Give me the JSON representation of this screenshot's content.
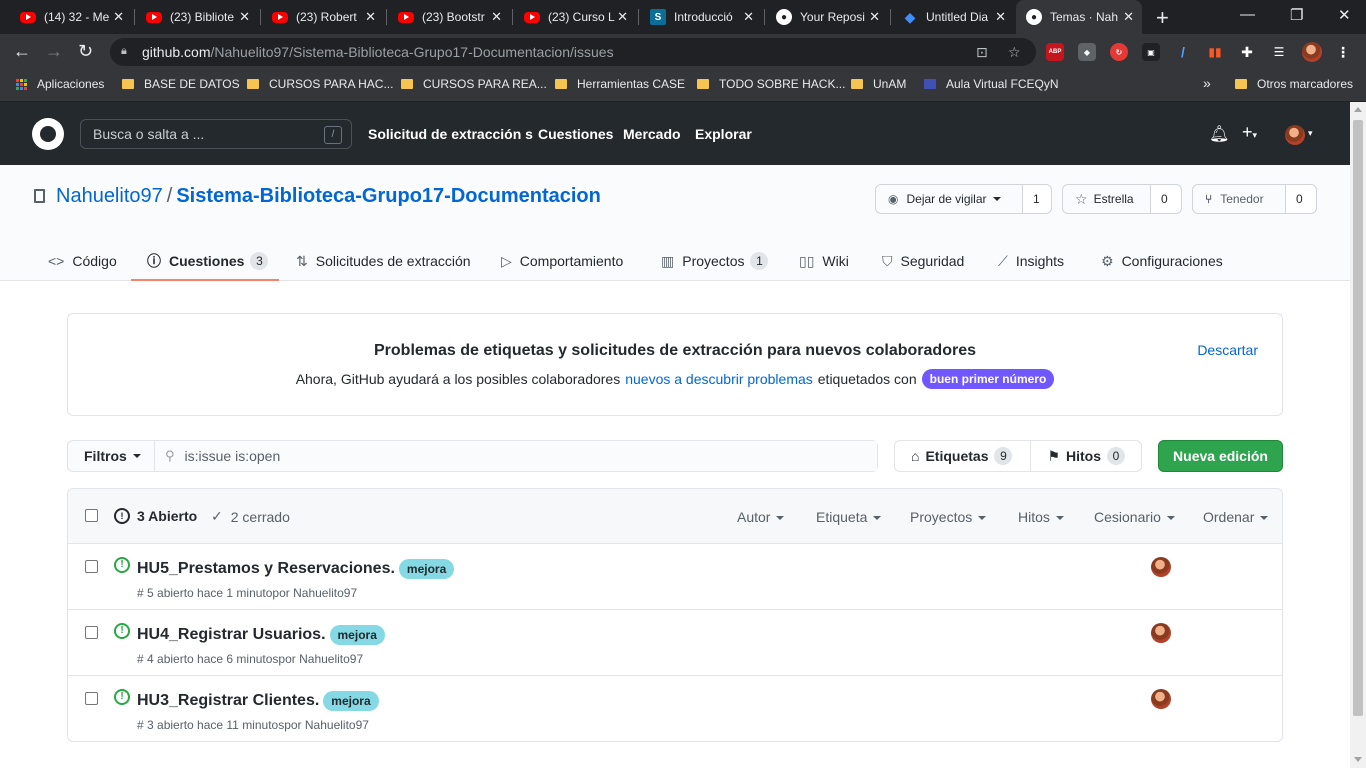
{
  "browser": {
    "tabs": [
      {
        "title": "(14) 32 - Me",
        "icon": "youtube-icon"
      },
      {
        "title": "(23) Bibliote",
        "icon": "youtube-icon"
      },
      {
        "title": "(23) Robert",
        "icon": "youtube-icon"
      },
      {
        "title": "(23) Bootstr",
        "icon": "youtube-icon"
      },
      {
        "title": "(23) Curso L",
        "icon": "youtube-icon"
      },
      {
        "title": "Introducció",
        "icon": "stackedit-icon"
      },
      {
        "title": "Your Reposi",
        "icon": "github-icon"
      },
      {
        "title": "Untitled Dia",
        "icon": "drawio-icon"
      },
      {
        "title": "Temas · Nah",
        "icon": "github-icon"
      }
    ],
    "url_host": "github.com",
    "url_path": "/Nahuelito97/Sistema-Biblioteca-Grupo17-Documentacion/issues",
    "bookmarks": [
      "Aplicaciones",
      "BASE DE DATOS",
      "CURSOS PARA HAC...",
      "CURSOS PARA REA...",
      "Herramientas CASE",
      "TODO SOBRE HACK...",
      "UnAM",
      "Aula Virtual FCEQyN"
    ],
    "bookmarks_overflow": "»",
    "other_bookmarks": "Otros marcadores",
    "ext_abp": "ABP"
  },
  "github": {
    "search_placeholder": "Busca o salta a ...",
    "search_key": "/",
    "nav": [
      "Solicitud de extracción s",
      "Cuestiones",
      "Mercado",
      "Explorar"
    ],
    "owner": "Nahuelito97",
    "repo": "Sistema-Biblioteca-Grupo17-Documentacion",
    "watch_label": "Dejar de vigilar",
    "watch_count": "1",
    "star_label": "Estrella",
    "star_count": "0",
    "fork_label": "Tenedor",
    "fork_count": "0",
    "tabs": [
      {
        "label": "Código"
      },
      {
        "label": "Cuestiones",
        "count": "3"
      },
      {
        "label": "Solicitudes de extracción"
      },
      {
        "label": "Comportamiento"
      },
      {
        "label": "Proyectos",
        "count": "1"
      },
      {
        "label": "Wiki"
      },
      {
        "label": "Seguridad"
      },
      {
        "label": "Insights"
      },
      {
        "label": "Configuraciones"
      }
    ]
  },
  "banner": {
    "title": "Problemas de etiquetas y solicitudes de extracción para nuevos colaboradores",
    "text_before": "Ahora, GitHub ayudará a los posibles colaboradores",
    "link": "nuevos a descubrir problemas",
    "text_after": "etiquetados con",
    "label": "buen primer número",
    "dismiss": "Descartar"
  },
  "filters": {
    "button": "Filtros",
    "query": "is:issue is:open",
    "labels": "Etiquetas",
    "labels_count": "9",
    "milestones": "Hitos",
    "milestones_count": "0",
    "new_issue": "Nueva edición"
  },
  "issues": {
    "open_label": "3 Abierto",
    "closed_label": "2 cerrado",
    "sort_menus": [
      "Autor",
      "Etiqueta",
      "Proyectos",
      "Hitos",
      "Cesionario",
      "Ordenar"
    ],
    "list": [
      {
        "title": "HU5_Prestamos y Reservaciones.",
        "label": "mejora",
        "meta": "# 5 abierto hace 1 minutopor Nahuelito97"
      },
      {
        "title": "HU4_Registrar Usuarios.",
        "label": "mejora",
        "meta": "# 4 abierto hace 6 minutospor Nahuelito97"
      },
      {
        "title": "HU3_Registrar Clientes.",
        "label": "mejora",
        "meta": "# 3 abierto hace 11 minutospor Nahuelito97"
      }
    ]
  },
  "colors": {
    "accent_green": "#2ea44f",
    "label_mejora": "#84d9e4",
    "label_good_first": "#7057ff",
    "tab_underline": "#f9826c"
  }
}
